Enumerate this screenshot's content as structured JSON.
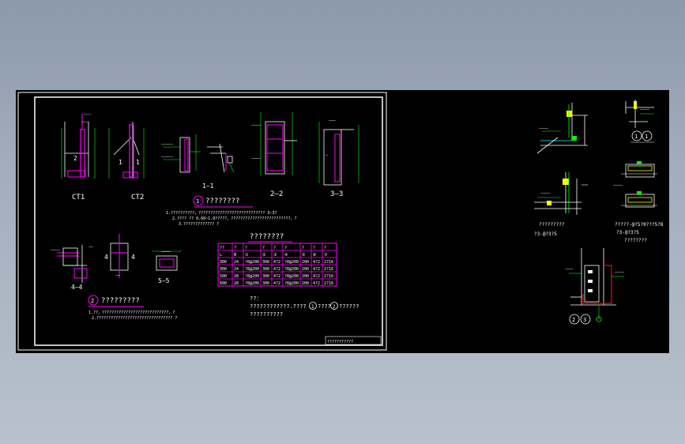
{
  "colors": {
    "background": "#000000",
    "line": "#ffffff",
    "dimension": "#00ff00",
    "member": "#ff00ff",
    "steel": "#ffff00",
    "highlight": "#ff0000",
    "annotation": "#00ffff"
  },
  "labels": {
    "ct1": "CT1",
    "ct2": "CT2",
    "sec_1_1": "1—1",
    "sec_2_2": "2—2",
    "sec_3_3": "3—3",
    "sec_4_4": "4—4",
    "sec_5_5": "5—5",
    "detail1_num": "1",
    "detail1_title": "????????",
    "detail2_num": "2",
    "detail2_title": "?????????",
    "table_title": "????????",
    "notes_title": "??：",
    "notes_line1": "????????????.????",
    "notes_ref1": "1",
    "notes_ref1_text": "????",
    "notes_ref2": "2",
    "notes_ref2_text": "??????",
    "notes_line2": "??????????",
    "titleblock": "???????????",
    "right_caption1": "?????????",
    "right_caption1b": "?3-@?3?5",
    "right_caption2": "?????-@?5?0???5?8",
    "right_caption2b": "?3-@?3?5",
    "right_caption2c": "????????",
    "circle_a": "1",
    "circle_b": "1",
    "circle_c": "2",
    "circle_d": "3"
  },
  "table": {
    "headers": [
      "??",
      "?",
      "?",
      "?",
      "?",
      "?",
      "?",
      "?",
      "?"
    ],
    "subheaders": [
      "L",
      "N",
      "①",
      "②",
      "③",
      "④",
      "⑤",
      "⑥",
      "⑦"
    ],
    "rows": [
      [
        "300",
        "24",
        "?8@200",
        "300",
        "4?2",
        "?8@200",
        "200",
        "4?2",
        "2?16"
      ],
      [
        "300",
        "24",
        "?8@200",
        "300",
        "4?2",
        "?8@200",
        "200",
        "4?2",
        "2?16"
      ],
      [
        "500",
        "28",
        "?8@200",
        "300",
        "4?2",
        "?8@200",
        "200",
        "4?2",
        "2?16"
      ],
      [
        "600",
        "28",
        "?8@200",
        "300",
        "4?2",
        "?8@200",
        "200",
        "4?2",
        "2?16"
      ]
    ]
  }
}
